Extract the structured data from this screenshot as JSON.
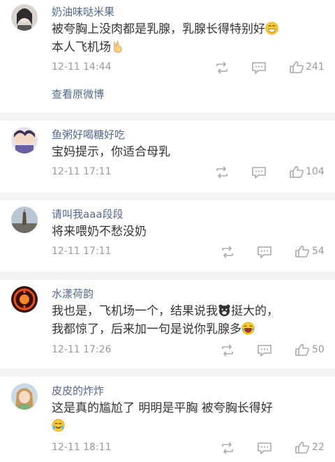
{
  "comments": [
    {
      "user": "奶油味哒米果",
      "text_line1": "被夸胸上没肉都是乳腺，乳腺长得特别好",
      "text_line2": "本人飞机场",
      "emoji1": "grin-emoji-icon",
      "emoji2": "victory-hand-emoji-icon",
      "time": "12-11 14:44",
      "likes": "241",
      "view_original": "查看原微博"
    },
    {
      "user": "鱼粥好喝糖好吃",
      "text_line1": "宝妈提示，你适合母乳",
      "time": "12-11 17:11",
      "likes": "104"
    },
    {
      "user": "请叫我aaa段段",
      "text_line1": "将来喂奶不愁没奶",
      "time": "12-11 17:11",
      "likes": "54"
    },
    {
      "user": "水漾荷韵",
      "text_line1a": "我也是，飞机场一个，结果说我",
      "text_line1b": "挺大的，",
      "text_line2": "我都惊了，后来加一句是说你乳腺多",
      "emoji1": "bear-emoji-icon",
      "emoji2": "laugh-tears-emoji-icon",
      "time": "12-11 17:26",
      "likes": "50"
    },
    {
      "user": "皮皮的炸炸",
      "text_line1": "这是真的尴尬了 明明是平胸 被夸胸长得好",
      "emoji1": "cry-laugh-emoji-icon",
      "time": "12-11 18:11",
      "likes": "22"
    }
  ],
  "colors": {
    "username": "#53698a",
    "meta": "#999999",
    "text": "#333333",
    "separator": "#f2f2f2"
  }
}
